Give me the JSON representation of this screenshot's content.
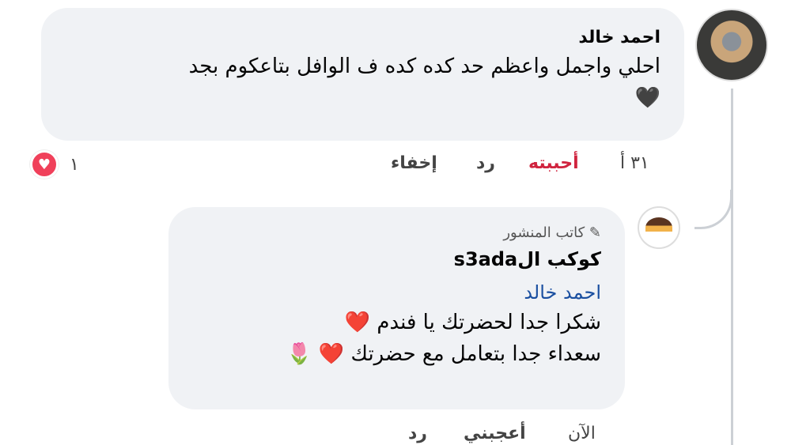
{
  "comment": {
    "author": "احمد خالد",
    "text": "احلي واجمل واعظم حد كده كده ف  الوافل بتاعكوم بجد",
    "emoji": "🖤",
    "time": "٣١ أ",
    "like_label": "أحببته",
    "reply_label": "رد",
    "hide_label": "إخفاء",
    "reaction_count": "١",
    "reaction_icon": "love-reaction",
    "like_color": "#d0243f"
  },
  "reply": {
    "badge_label": "كاتب المنشور",
    "author": "كوكب الs3ada",
    "mention": "احمد خالد",
    "line1": "شكرا جدا لحضرتك يا فندم ❤️",
    "line2": "سعداء جدا بتعامل مع حضرتك ❤️ 🌷",
    "time": "الآن",
    "like_label": "أعجبني",
    "reply_label": "رد"
  }
}
